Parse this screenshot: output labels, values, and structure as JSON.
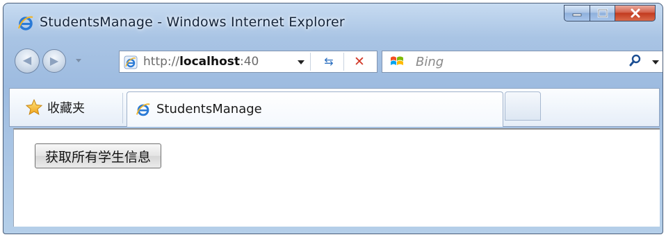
{
  "window": {
    "title": "StudentsManage - Windows Internet Explorer"
  },
  "navbar": {
    "address": {
      "scheme": "http://",
      "host": "localhost",
      "port": ":40"
    },
    "search_placeholder": "Bing"
  },
  "tabbar": {
    "favorites_label": "收藏夹",
    "active_tab_label": "StudentsManage"
  },
  "content": {
    "button_label": "获取所有学生信息"
  },
  "colors": {
    "close_button": "#c23a1f",
    "frame": "#a9c4e4",
    "stop": "#d23a2a",
    "refresh": "#2c6fc0"
  }
}
